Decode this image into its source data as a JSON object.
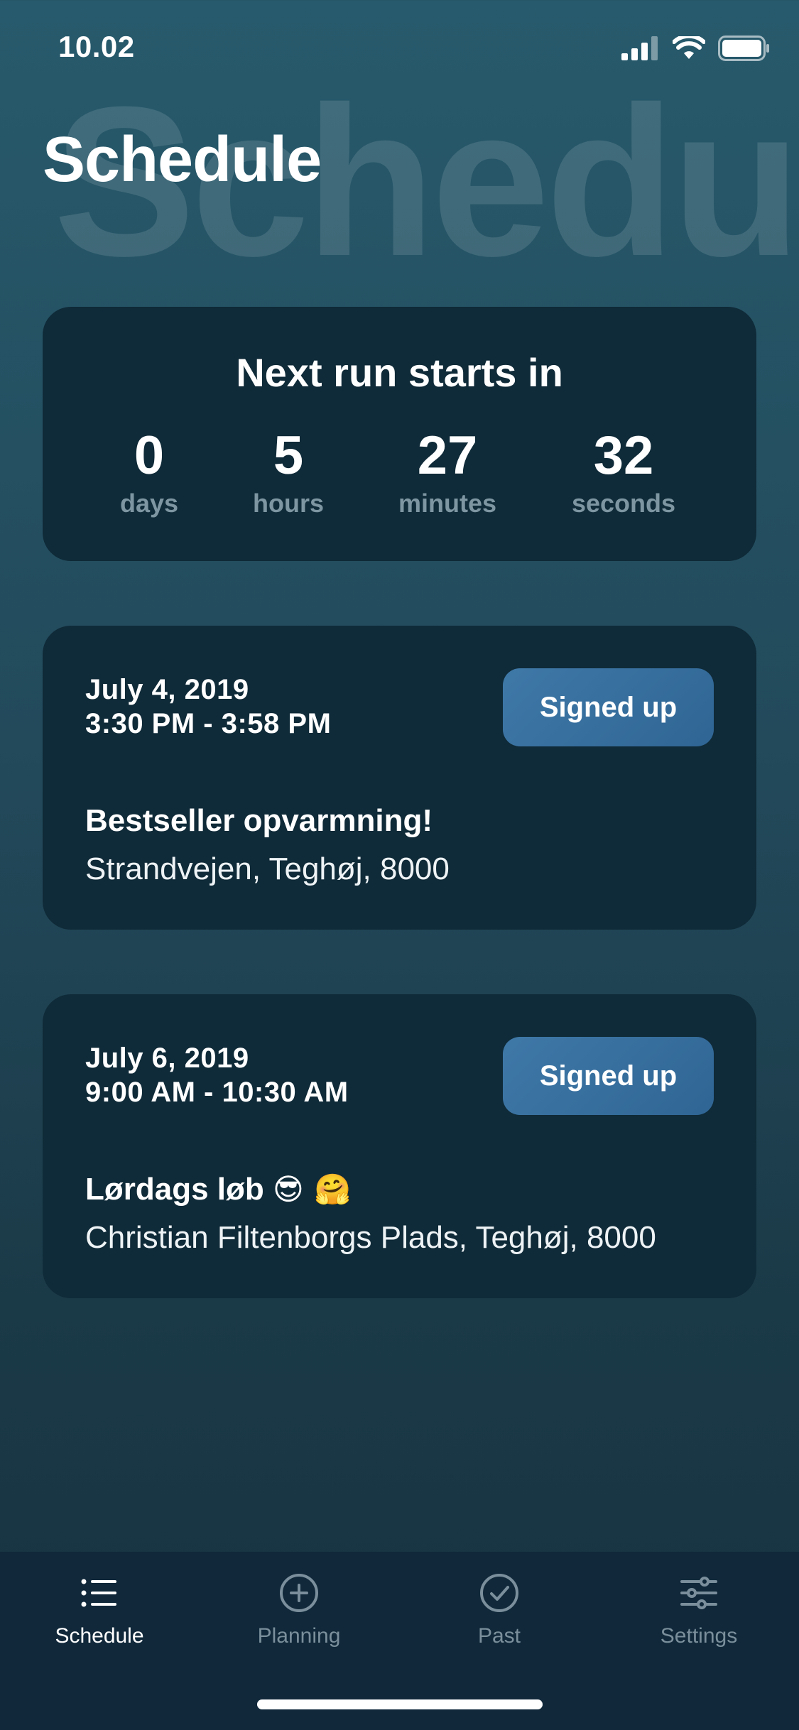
{
  "status_bar": {
    "time": "10.02"
  },
  "header": {
    "title": "Schedule",
    "background_title": "Schedule"
  },
  "countdown": {
    "heading": "Next run starts in",
    "units": [
      {
        "value": "0",
        "label": "days"
      },
      {
        "value": "5",
        "label": "hours"
      },
      {
        "value": "27",
        "label": "minutes"
      },
      {
        "value": "32",
        "label": "seconds"
      }
    ]
  },
  "runs": [
    {
      "date": "July 4, 2019",
      "time": "3:30 PM - 3:58 PM",
      "button_label": "Signed up",
      "title": "Bestseller opvarmning!",
      "emoji": "",
      "location": "Strandvejen, Teghøj, 8000"
    },
    {
      "date": "July 6, 2019",
      "time": "9:00 AM - 10:30 AM",
      "button_label": "Signed up",
      "title": "Lørdags løb",
      "emoji": "😎 🤗",
      "location": "Christian Filtenborgs Plads, Teghøj, 8000"
    }
  ],
  "tab_bar": {
    "tabs": [
      {
        "label": "Schedule",
        "icon": "list-icon",
        "active": true
      },
      {
        "label": "Planning",
        "icon": "plus-circle-icon",
        "active": false
      },
      {
        "label": "Past",
        "icon": "check-circle-icon",
        "active": false
      },
      {
        "label": "Settings",
        "icon": "sliders-icon",
        "active": false
      }
    ]
  },
  "colors": {
    "card_bg": "#0f2a38",
    "button_bg": "#3f79a8",
    "inactive_tab": "#7a8f9b",
    "countdown_label": "#7d96a2"
  }
}
